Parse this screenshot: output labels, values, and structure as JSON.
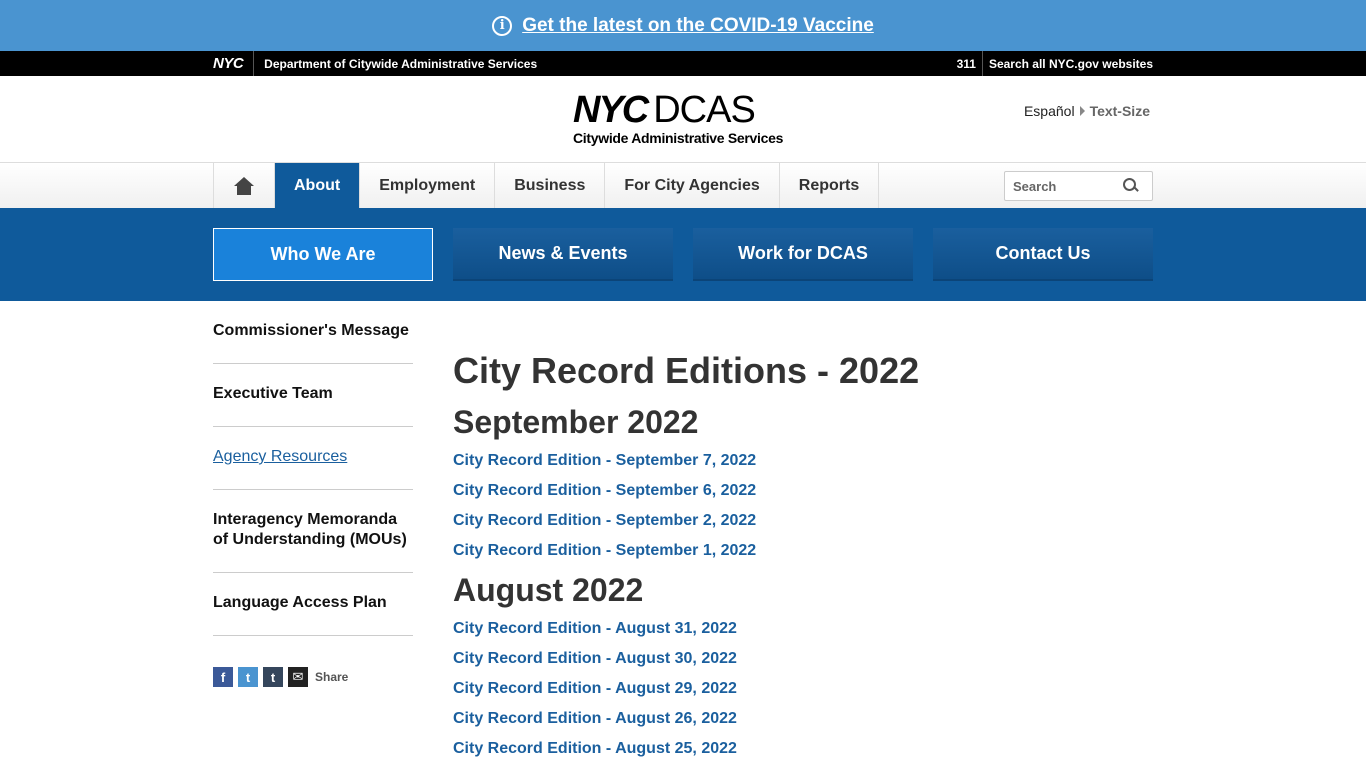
{
  "banner": {
    "text": "Get the latest on the COVID-19 Vaccine",
    "icon": "info-icon"
  },
  "topbar": {
    "logo": "NYC",
    "department": "Department of Citywide Administrative Services",
    "n311": "311",
    "search_all": "Search all NYC.gov websites"
  },
  "header": {
    "logo_nyc": "NYC",
    "logo_dcas": "DCAS",
    "logo_sub": "Citywide Administrative Services",
    "espanol": "Español",
    "text_size": "Text-Size"
  },
  "mainnav": {
    "items": [
      "About",
      "Employment",
      "Business",
      "For City Agencies",
      "Reports"
    ],
    "active": "About",
    "search_placeholder": "Search"
  },
  "subnav": {
    "tiles": [
      "Who We Are",
      "News & Events",
      "Work for DCAS",
      "Contact Us"
    ],
    "active": "Who We Are"
  },
  "sidebar": {
    "items": [
      "Commissioner's Message",
      "Executive Team",
      "Agency Resources",
      "Interagency Memoranda of Understanding (MOUs)",
      "Language Access Plan"
    ],
    "share_label": "Share"
  },
  "content": {
    "title": "City Record Editions - 2022",
    "sections": [
      {
        "heading": "September 2022",
        "links": [
          "City Record Edition - September 7, 2022",
          "City Record Edition - September 6, 2022",
          "City Record Edition - September 2, 2022",
          "City Record Edition - September 1, 2022"
        ]
      },
      {
        "heading": "August 2022",
        "links": [
          "City Record Edition - August 31, 2022",
          "City Record Edition - August 30, 2022",
          "City Record Edition - August 29, 2022",
          "City Record Edition - August 26, 2022",
          "City Record Edition - August 25, 2022"
        ]
      }
    ]
  },
  "colors": {
    "nav_blue": "#0f5a9b",
    "banner_blue": "#4a94d0",
    "link_blue": "#1a5f9e",
    "active_tile": "#1a82da"
  }
}
